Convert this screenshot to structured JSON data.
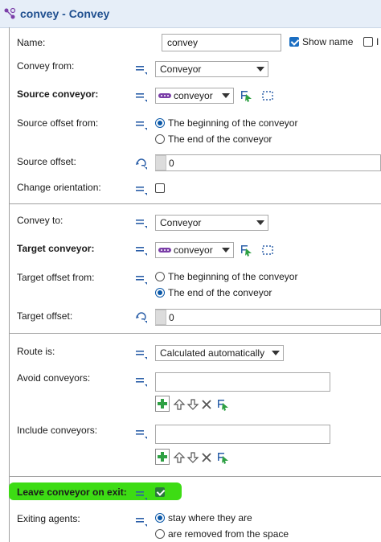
{
  "window": {
    "title": "convey - Convey"
  },
  "name": {
    "label": "Name:",
    "value": "convey",
    "show_name_label": "Show name",
    "show_name_checked": true,
    "next_cut": "I"
  },
  "convey_from": {
    "label": "Convey from:",
    "value": "Conveyor"
  },
  "source_conveyor": {
    "label": "Source conveyor:",
    "value": "conveyor"
  },
  "source_offset_from": {
    "label": "Source offset from:",
    "option1": "The beginning of the conveyor",
    "option2": "The end of the conveyor",
    "selected": 1
  },
  "source_offset": {
    "label": "Source offset:",
    "value": "0"
  },
  "change_orientation": {
    "label": "Change orientation:",
    "checked": false
  },
  "convey_to": {
    "label": "Convey to:",
    "value": "Conveyor"
  },
  "target_conveyor": {
    "label": "Target conveyor:",
    "value": "conveyor"
  },
  "target_offset_from": {
    "label": "Target offset from:",
    "option1": "The beginning of the conveyor",
    "option2": "The end of the conveyor",
    "selected": 2
  },
  "target_offset": {
    "label": "Target offset:",
    "value": "0"
  },
  "route_is": {
    "label": "Route is:",
    "value": "Calculated automatically"
  },
  "avoid_conveyors": {
    "label": "Avoid conveyors:",
    "value": ""
  },
  "include_conveyors": {
    "label": "Include conveyors:",
    "value": ""
  },
  "leave_conveyor": {
    "label": "Leave conveyor on exit:",
    "checked": true,
    "highlight_color": "#3ddc14"
  },
  "exiting_agents": {
    "label": "Exiting agents:",
    "option1": "stay where they are",
    "option2": "are removed from the space",
    "selected": 1
  },
  "colors": {
    "accent": "#1b6ec2",
    "title": "#1f4f8f",
    "radio": "#0a58a8"
  }
}
